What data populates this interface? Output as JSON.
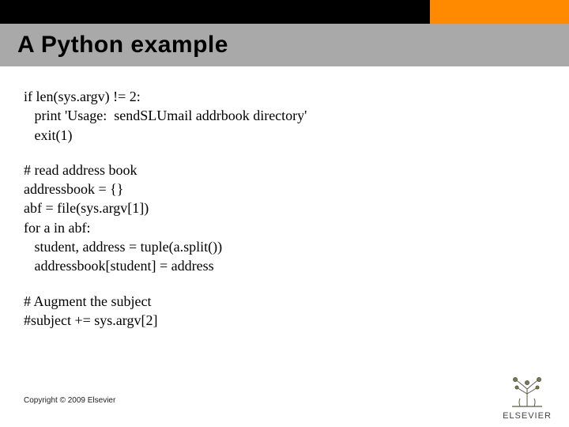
{
  "header": {
    "title": "A Python example"
  },
  "code": {
    "block1": "if len(sys.argv) != 2:\n   print 'Usage:  sendSLUmail addrbook directory'\n   exit(1)",
    "block2": "# read address book\naddressbook = {}\nabf = file(sys.argv[1])\nfor a in abf:\n   student, address = tuple(a.split())\n   addressbook[student] = address",
    "block3": "# Augment the subject\n#subject += sys.argv[2]"
  },
  "footer": {
    "copyright": "Copyright © 2009 Elsevier",
    "publisher": "ELSEVIER"
  },
  "colors": {
    "accent": "#ff8a00",
    "titlebar": "#a9a9a9",
    "topbar": "#000000"
  }
}
